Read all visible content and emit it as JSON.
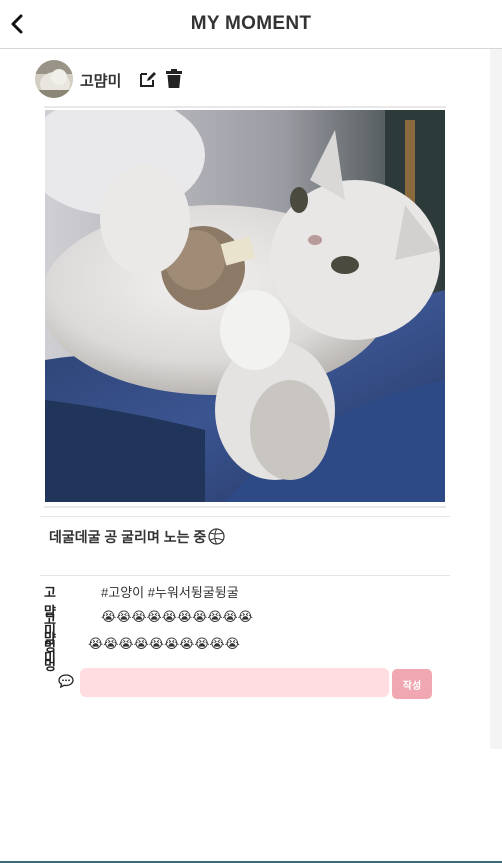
{
  "header": {
    "title": "MY MOMENT",
    "back_icon": "chevron-left-icon"
  },
  "post": {
    "author": "고먐미",
    "edit_icon": "edit-icon",
    "delete_icon": "trash-icon",
    "photo_icon": "cat-photo",
    "caption": "데굴데굴 공 굴리며 노는 중",
    "caption_emoji": "volleyball-icon"
  },
  "comments": [
    {
      "author": "고먐미",
      "text": "#고양이 #누워서뒹굴뒹굴"
    },
    {
      "author": "고먐미",
      "text": "😭😭😭😭😭😭😭😭😭😭"
    },
    {
      "author": "멍멍",
      "text": "😭😭😭😭😭😭😭😭😭😭"
    }
  ],
  "comment_form": {
    "icon": "comment-bubble-icon",
    "placeholder": "",
    "value": "",
    "submit_label": "작성"
  },
  "colors": {
    "input_bg": "#ffdde1",
    "submit_bg": "#f0a7b1",
    "bottom_bar": "#3c6b7e"
  }
}
